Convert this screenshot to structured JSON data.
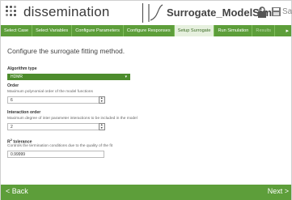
{
  "header": {
    "app_name": "dissemination",
    "model_title": "Surrogate_ModelSim",
    "save_label": "Save"
  },
  "tabs": [
    {
      "label": "Select Case"
    },
    {
      "label": "Select Variables"
    },
    {
      "label": "Configure Parameters"
    },
    {
      "label": "Configure Responses"
    },
    {
      "label": "Setup Surrogate"
    },
    {
      "label": "Run Simulation"
    },
    {
      "label": "Results"
    }
  ],
  "active_tab": "Setup Surrogate",
  "main": {
    "heading": "Configure the surrogate fitting method.",
    "algorithm": {
      "label": "Algorithm type",
      "value": "HDMR"
    },
    "order": {
      "label": "Order",
      "description": "Maximum polynomial order of the model functions",
      "value": "6"
    },
    "interaction": {
      "label": "Interaction order",
      "description": "Maximum degree of inter parameter interactions to be included in the model",
      "value": "2"
    },
    "r2": {
      "label_main": "R",
      "label_sup": "2",
      "label_rest": " tolerance",
      "description": "Controls the termination conditions due to the quality of the fit",
      "value": "0.99999"
    }
  },
  "footer": {
    "back_label": "< Back",
    "next_label": "Next >"
  },
  "colors": {
    "accent": "#5d9e3a",
    "accent_dark": "#4d8c2d"
  }
}
